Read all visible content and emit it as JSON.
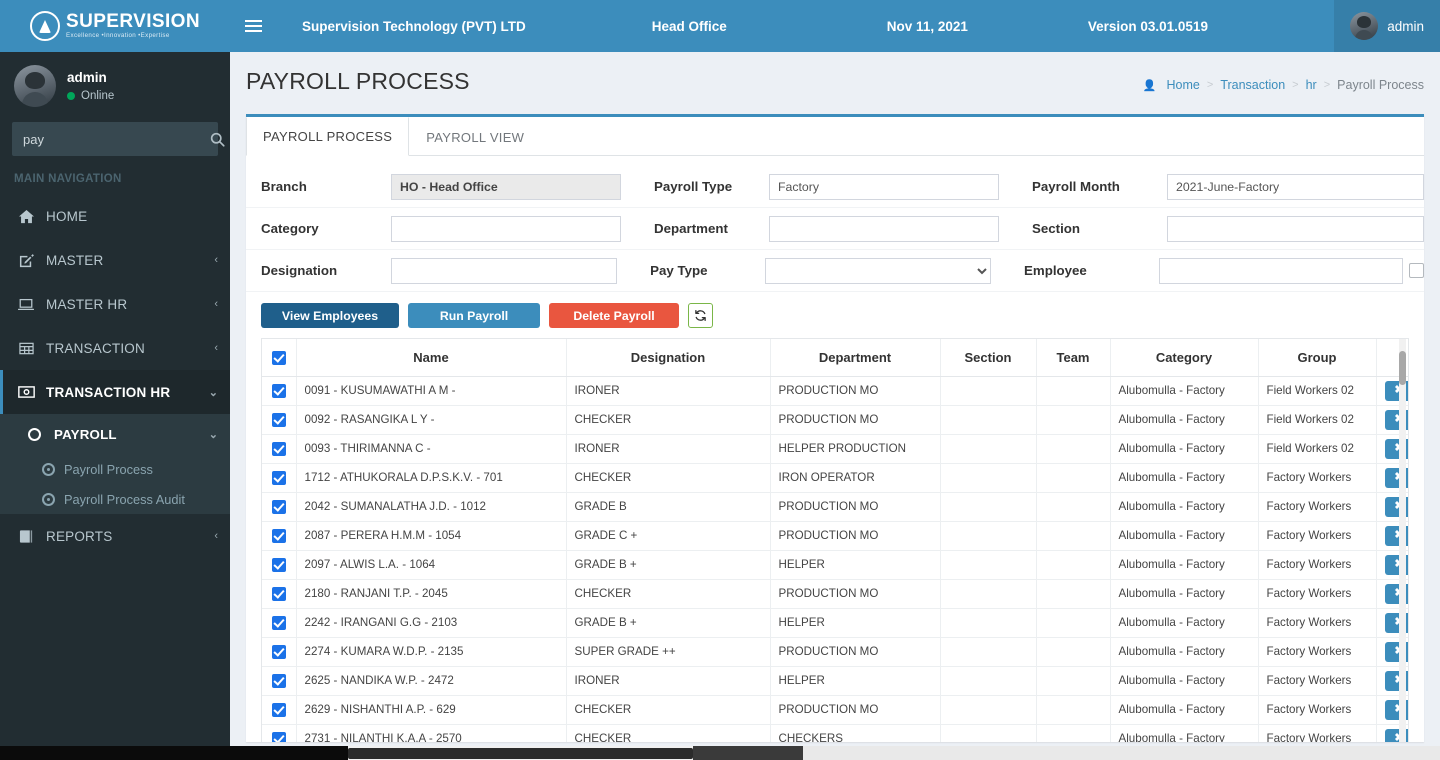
{
  "brand": {
    "name": "SUPERVISION",
    "tagline": "Excellence •Innovation •Expertise",
    "logo_icon": "droplet-circle-icon",
    "accent": "#3c8dbc",
    "sidebar_bg": "#222d32"
  },
  "user_panel": {
    "name": "admin",
    "status": "Online",
    "status_color": "#00a65a"
  },
  "sidebar": {
    "search": {
      "value": "pay",
      "placeholder": "",
      "icon": "search-icon"
    },
    "nav_header": "MAIN NAVIGATION",
    "items": [
      {
        "label": "HOME",
        "icon": "home-icon",
        "arrow": ""
      },
      {
        "label": "MASTER",
        "icon": "edit-icon",
        "arrow": "‹"
      },
      {
        "label": "MASTER HR",
        "icon": "laptop-icon",
        "arrow": "‹"
      },
      {
        "label": "TRANSACTION",
        "icon": "table-icon",
        "arrow": "‹"
      },
      {
        "label": "TRANSACTION HR",
        "icon": "money-icon",
        "arrow": "⌄"
      },
      {
        "label": "REPORTS",
        "icon": "book-icon",
        "arrow": "‹"
      }
    ],
    "sub": {
      "label": "PAYROLL",
      "icon": "circle-icon",
      "arrow": "⌄",
      "leaves": [
        {
          "label": "Payroll Process",
          "icon": "gear-icon"
        },
        {
          "label": "Payroll Process Audit",
          "icon": "gear-icon"
        }
      ]
    }
  },
  "topbar": {
    "menu_icon": "hamburger-icon",
    "company": "Supervision Technology (PVT) LTD",
    "office": "Head Office",
    "date": "Nov 11, 2021",
    "version": "Version 03.01.0519",
    "username": "admin"
  },
  "page": {
    "title": "PAYROLL PROCESS",
    "breadcrumb": {
      "home": "Home",
      "level2": "Transaction",
      "level3": "hr",
      "current": "Payroll Process",
      "separator": ">"
    }
  },
  "tabs": [
    {
      "label": "PAYROLL PROCESS",
      "active": true
    },
    {
      "label": "PAYROLL VIEW",
      "active": false
    }
  ],
  "filters": {
    "branch": {
      "label": "Branch",
      "value": "HO - Head Office",
      "readonly": true
    },
    "payroll_type": {
      "label": "Payroll Type",
      "value": "Factory"
    },
    "payroll_month": {
      "label": "Payroll Month",
      "value": "2021-June-Factory"
    },
    "category": {
      "label": "Category",
      "value": ""
    },
    "department": {
      "label": "Department",
      "value": ""
    },
    "section": {
      "label": "Section",
      "value": ""
    },
    "designation": {
      "label": "Designation",
      "value": ""
    },
    "pay_type": {
      "label": "Pay Type",
      "value": "",
      "options": [
        ""
      ]
    },
    "employee": {
      "label": "Employee",
      "value": "",
      "checkbox_checked": false
    }
  },
  "actions": {
    "view_employees": "View Employees",
    "run_payroll": "Run Payroll",
    "delete_payroll": "Delete Payroll",
    "refresh_icon": "refresh-icon",
    "view_color": "#1f5f8b",
    "run_color": "#3c8dbc",
    "delete_color": "#e9563f"
  },
  "table": {
    "select_all_checked": true,
    "columns": [
      "",
      "Name",
      "Designation",
      "Department",
      "Section",
      "Team",
      "Category",
      "Group",
      ""
    ],
    "row_action_icon": "remove-x-icon",
    "rows": [
      {
        "checked": true,
        "name": "0091 - KUSUMAWATHI A M -",
        "designation": "IRONER",
        "department": "PRODUCTION MO",
        "section": "",
        "team": "",
        "category": "Alubomulla - Factory",
        "group": "Field Workers 02"
      },
      {
        "checked": true,
        "name": "0092 - RASANGIKA L Y -",
        "designation": "CHECKER",
        "department": "PRODUCTION MO",
        "section": "",
        "team": "",
        "category": "Alubomulla - Factory",
        "group": "Field Workers 02"
      },
      {
        "checked": true,
        "name": "0093 - THIRIMANNA C -",
        "designation": "IRONER",
        "department": "HELPER PRODUCTION",
        "section": "",
        "team": "",
        "category": "Alubomulla - Factory",
        "group": "Field Workers 02"
      },
      {
        "checked": true,
        "name": "1712 - ATHUKORALA D.P.S.K.V. - 701",
        "designation": "CHECKER",
        "department": "IRON OPERATOR",
        "section": "",
        "team": "",
        "category": "Alubomulla - Factory",
        "group": "Factory Workers"
      },
      {
        "checked": true,
        "name": "2042 - SUMANALATHA J.D. - 1012",
        "designation": "GRADE B",
        "department": "PRODUCTION MO",
        "section": "",
        "team": "",
        "category": "Alubomulla - Factory",
        "group": "Factory Workers"
      },
      {
        "checked": true,
        "name": "2087 - PERERA H.M.M - 1054",
        "designation": "GRADE C +",
        "department": "PRODUCTION MO",
        "section": "",
        "team": "",
        "category": "Alubomulla - Factory",
        "group": "Factory Workers"
      },
      {
        "checked": true,
        "name": "2097 - ALWIS L.A. - 1064",
        "designation": "GRADE B +",
        "department": "HELPER",
        "section": "",
        "team": "",
        "category": "Alubomulla - Factory",
        "group": "Factory Workers"
      },
      {
        "checked": true,
        "name": "2180 - RANJANI T.P. - 2045",
        "designation": "CHECKER",
        "department": "PRODUCTION MO",
        "section": "",
        "team": "",
        "category": "Alubomulla - Factory",
        "group": "Factory Workers"
      },
      {
        "checked": true,
        "name": "2242 - IRANGANI G.G - 2103",
        "designation": "GRADE B +",
        "department": "HELPER",
        "section": "",
        "team": "",
        "category": "Alubomulla - Factory",
        "group": "Factory Workers"
      },
      {
        "checked": true,
        "name": "2274 - KUMARA W.D.P. - 2135",
        "designation": "SUPER GRADE ++",
        "department": "PRODUCTION MO",
        "section": "",
        "team": "",
        "category": "Alubomulla - Factory",
        "group": "Factory Workers"
      },
      {
        "checked": true,
        "name": "2625 - NANDIKA W.P. - 2472",
        "designation": "IRONER",
        "department": "HELPER",
        "section": "",
        "team": "",
        "category": "Alubomulla - Factory",
        "group": "Factory Workers"
      },
      {
        "checked": true,
        "name": "2629 - NISHANTHI A.P. - 629",
        "designation": "CHECKER",
        "department": "PRODUCTION MO",
        "section": "",
        "team": "",
        "category": "Alubomulla - Factory",
        "group": "Factory Workers"
      },
      {
        "checked": true,
        "name": "2731 - NILANTHI K.A.A - 2570",
        "designation": "CHECKER",
        "department": "CHECKERS",
        "section": "",
        "team": "",
        "category": "Alubomulla - Factory",
        "group": "Factory Workers"
      }
    ]
  }
}
